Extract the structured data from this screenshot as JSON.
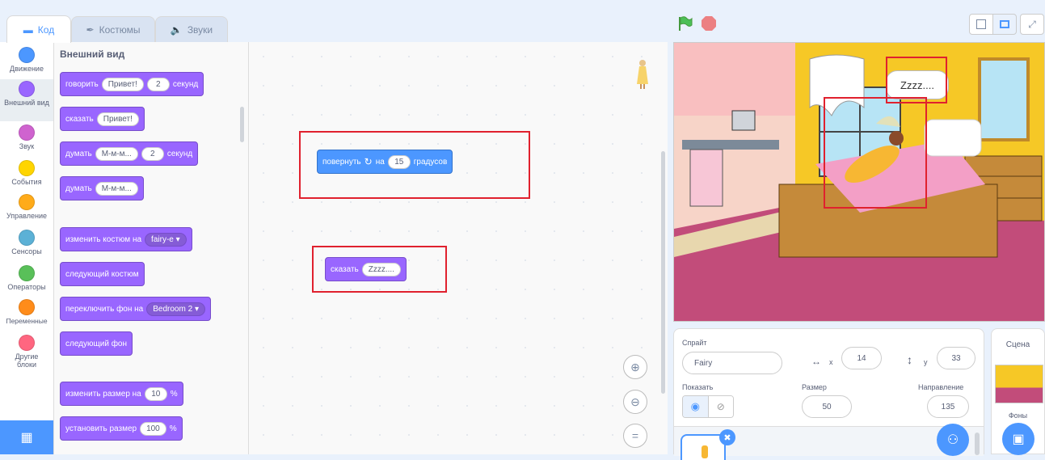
{
  "tabs": {
    "code": "Код",
    "costumes": "Костюмы",
    "sounds": "Звуки"
  },
  "categories": [
    {
      "label": "Движение",
      "color": "#4c97ff"
    },
    {
      "label": "Внешний вид",
      "color": "#9966ff"
    },
    {
      "label": "Звук",
      "color": "#cf63cf"
    },
    {
      "label": "События",
      "color": "#ffd500"
    },
    {
      "label": "Управление",
      "color": "#ffab19"
    },
    {
      "label": "Сенсоры",
      "color": "#5cb1d6"
    },
    {
      "label": "Операторы",
      "color": "#59c059"
    },
    {
      "label": "Переменные",
      "color": "#ff8c1a"
    },
    {
      "label": "Другие блоки",
      "color": "#ff6680"
    }
  ],
  "palette": {
    "heading": "Внешний вид",
    "say_secs": {
      "word": "говорить",
      "text": "Привет!",
      "secs": "2",
      "unit": "секунд"
    },
    "say": {
      "word": "сказать",
      "text": "Привет!"
    },
    "think_secs": {
      "word": "думать",
      "text": "М-м-м...",
      "secs": "2",
      "unit": "секунд"
    },
    "think": {
      "word": "думать",
      "text": "М-м-м..."
    },
    "switch_costume": {
      "word": "изменить костюм на",
      "value": "fairy-e"
    },
    "next_costume": "следующий костюм",
    "switch_backdrop": {
      "word": "переключить фон на",
      "value": "Bedroom 2"
    },
    "next_backdrop": "следующий фон",
    "change_size": {
      "word": "изменить размер на",
      "value": "10",
      "unit": "%"
    },
    "set_size": {
      "word": "установить размер",
      "value": "100",
      "unit": "%"
    }
  },
  "script": {
    "turn": {
      "word": "повернуть",
      "on": "на",
      "value": "15",
      "unit": "градусов"
    },
    "say": {
      "word": "сказать",
      "text": "Zzzz...."
    }
  },
  "stage": {
    "speech": "Zzzz...."
  },
  "sprite_info": {
    "sprite_label": "Спрайт",
    "sprite_name": "Fairy",
    "x_label": "x",
    "x_value": "14",
    "y_label": "y",
    "y_value": "33",
    "show_label": "Показать",
    "size_label": "Размер",
    "size_value": "50",
    "direction_label": "Направление",
    "direction_value": "135"
  },
  "stage_pane": {
    "title": "Сцена",
    "backdrops_label": "Фоны"
  },
  "colors": {
    "motion": "#4c97ff",
    "looks": "#9966ff",
    "accent": "#855cd6",
    "highlight": "#e0212e"
  }
}
